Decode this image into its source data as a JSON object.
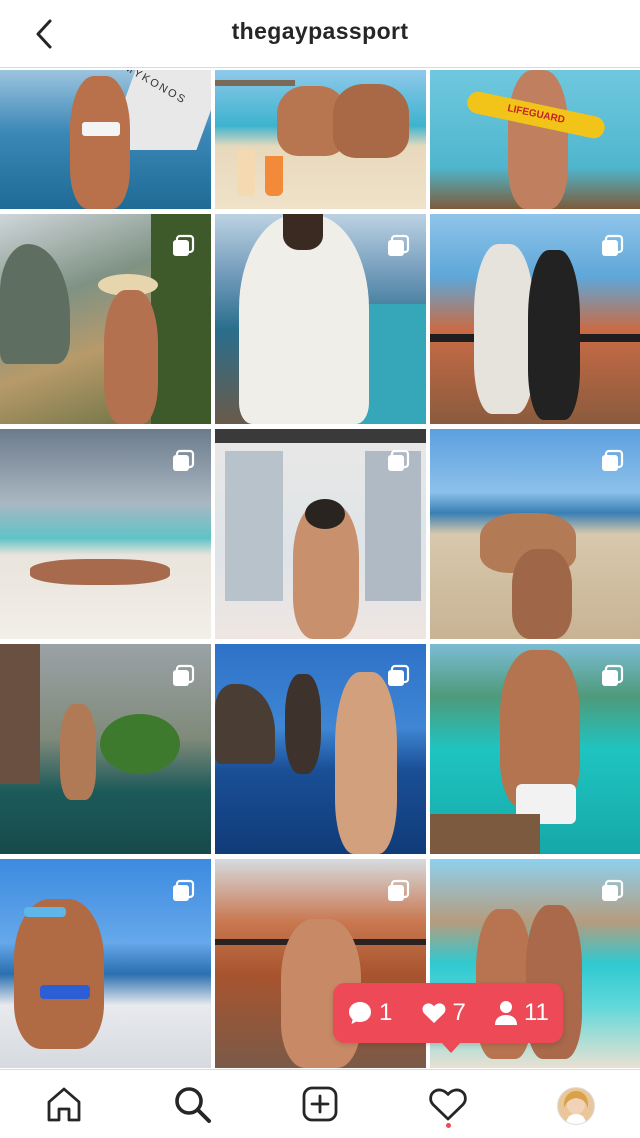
{
  "header": {
    "title": "thegaypassport",
    "back_icon": "chevron-left-icon"
  },
  "grid": {
    "columns": 3,
    "posts": [
      {
        "id": "post-1",
        "multi": false,
        "scene": "yacht Mykonos",
        "sign_text": "MYKONOS"
      },
      {
        "id": "post-2",
        "multi": false,
        "scene": "beach cocktails",
        "sign_text": ""
      },
      {
        "id": "post-3",
        "multi": false,
        "scene": "lifeguard turquoise sea",
        "sign_text": "LIFEGUARD"
      },
      {
        "id": "post-4",
        "multi": true,
        "scene": "cliff viewpoint hat"
      },
      {
        "id": "post-5",
        "multi": true,
        "scene": "white shirt infinity pool"
      },
      {
        "id": "post-6",
        "multi": true,
        "scene": "rooftop terrace"
      },
      {
        "id": "post-7",
        "multi": true,
        "scene": "white sand beach"
      },
      {
        "id": "post-8",
        "multi": true,
        "scene": "city window"
      },
      {
        "id": "post-9",
        "multi": true,
        "scene": "piggyback beach"
      },
      {
        "id": "post-10",
        "multi": true,
        "scene": "villa pool"
      },
      {
        "id": "post-11",
        "multi": true,
        "scene": "rock formation sea"
      },
      {
        "id": "post-12",
        "multi": true,
        "scene": "boat ladder lagoon"
      },
      {
        "id": "post-13",
        "multi": true,
        "scene": "yacht deck"
      },
      {
        "id": "post-14",
        "multi": true,
        "scene": "old town balcony"
      },
      {
        "id": "post-15",
        "multi": true,
        "scene": "turquoise beach couple"
      }
    ]
  },
  "notification": {
    "comments": "1",
    "likes": "7",
    "follows": "11"
  },
  "tabbar": {
    "items": [
      "home-icon",
      "search-icon",
      "add-post-icon",
      "activity-icon",
      "profile-avatar"
    ],
    "active": "search-icon"
  },
  "colors": {
    "notification_bg": "#ed4956",
    "text_primary": "#262626",
    "divider": "#dbdbdb"
  }
}
